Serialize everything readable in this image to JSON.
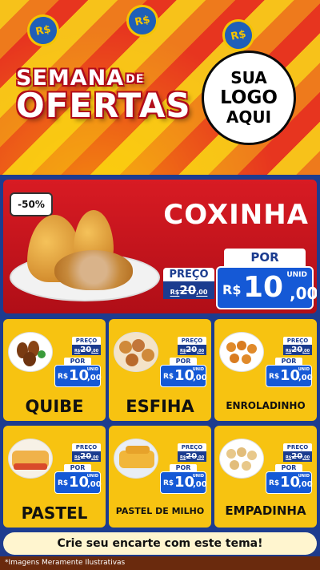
{
  "header": {
    "title_line1": "SEMANA",
    "title_de": "DE",
    "title_line2": "OFERTAS",
    "coin_label": "R$",
    "logo": {
      "line1": "SUA",
      "line2": "LOGO",
      "line3": "AQUI"
    }
  },
  "featured": {
    "discount": "-50%",
    "name": "COXINHA",
    "price_label": "PREÇO",
    "old_currency": "R$",
    "old_price": "20",
    "old_cents": ",00",
    "por_label": "POR",
    "currency": "R$",
    "price": "10",
    "cents": ",00",
    "unit": "UNID"
  },
  "products": [
    {
      "name": "QUIBE",
      "price_label": "PREÇO",
      "old_currency": "R$",
      "old_price": "20",
      "old_cents": ",00",
      "por_label": "POR",
      "currency": "R$",
      "price": "10",
      "cents": ",00",
      "unit": "UNID"
    },
    {
      "name": "ESFIHA",
      "price_label": "PREÇO",
      "old_currency": "R$",
      "old_price": "20",
      "old_cents": ",00",
      "por_label": "POR",
      "currency": "R$",
      "price": "10",
      "cents": ",00",
      "unit": "UNID"
    },
    {
      "name": "ENROLADINHO",
      "price_label": "PREÇO",
      "old_currency": "R$",
      "old_price": "20",
      "old_cents": ",00",
      "por_label": "POR",
      "currency": "R$",
      "price": "10",
      "cents": ",00",
      "unit": "UNID"
    },
    {
      "name": "PASTEL",
      "price_label": "PREÇO",
      "old_currency": "R$",
      "old_price": "20",
      "old_cents": ",00",
      "por_label": "POR",
      "currency": "R$",
      "price": "10",
      "cents": ",00",
      "unit": "UNID"
    },
    {
      "name": "PASTEL DE MILHO",
      "price_label": "PREÇO",
      "old_currency": "R$",
      "old_price": "20",
      "old_cents": ",00",
      "por_label": "POR",
      "currency": "R$",
      "price": "10",
      "cents": ",00",
      "unit": "UNID"
    },
    {
      "name": "EMPADINHA",
      "price_label": "PREÇO",
      "old_currency": "R$",
      "old_price": "20",
      "old_cents": ",00",
      "por_label": "POR",
      "currency": "R$",
      "price": "10",
      "cents": ",00",
      "unit": "UNID"
    }
  ],
  "cta": "Crie seu encarte com este tema!",
  "footnote": "*Imagens Meramente Ilustrativas",
  "colors": {
    "accent_red": "#c8141d",
    "card_yellow": "#f7c311",
    "price_blue": "#1559d6",
    "navy": "#1b3c8f"
  }
}
